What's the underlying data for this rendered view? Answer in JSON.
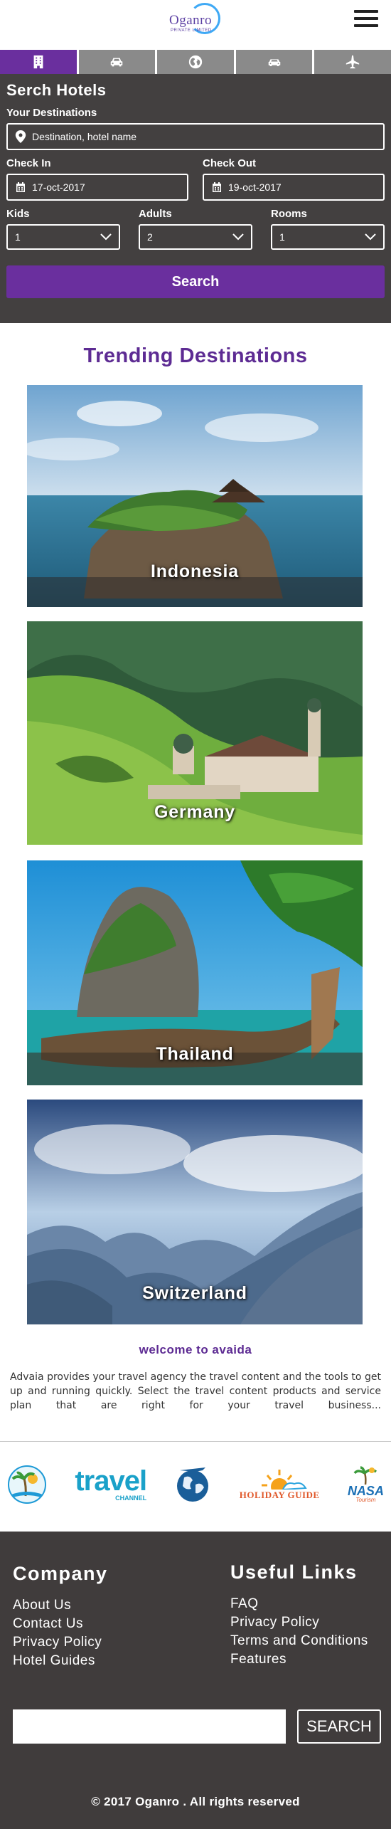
{
  "header": {
    "logo_text": "Oganro",
    "logo_sub": "PRIVATE LIMITED",
    "menu_icon": "hamburger-menu-icon"
  },
  "tabs": [
    {
      "icon": "hotel-building-icon",
      "active": true
    },
    {
      "icon": "car-icon",
      "active": false
    },
    {
      "icon": "globe-icon",
      "active": false
    },
    {
      "icon": "taxi-icon",
      "active": false
    },
    {
      "icon": "airplane-icon",
      "active": false
    }
  ],
  "search": {
    "title": "Serch Hotels",
    "destination_label": "Your Destinations",
    "destination_placeholder": "Destination, hotel name",
    "checkin_label": "Check In",
    "checkin_value": "17-oct-2017",
    "checkout_label": "Check Out",
    "checkout_value": "19-oct-2017",
    "kids_label": "Kids",
    "kids_value": "1",
    "adults_label": "Adults",
    "adults_value": "2",
    "rooms_label": "Rooms",
    "rooms_value": "1",
    "button_label": "Search"
  },
  "trending": {
    "title": "Trending Destinations",
    "destinations": [
      {
        "name": "Indonesia"
      },
      {
        "name": "Germany"
      },
      {
        "name": "Thailand"
      },
      {
        "name": "Switzerland"
      }
    ]
  },
  "welcome": {
    "title": "welcome to avaida",
    "text": "Advaia provides your travel agency the travel content and the tools to get up and running quickly. Select the travel content products and service plan that are right for your travel business..."
  },
  "partners": [
    {
      "name": "beach-resort-logo"
    },
    {
      "name": "Travel Channel",
      "text": "travel",
      "sub": "CHANNEL"
    },
    {
      "name": "globe-plane-logo"
    },
    {
      "name": "Holiday Guide",
      "text": "HOLIDAY GUIDE"
    },
    {
      "name": "NASA Tourism",
      "text": "NASA",
      "sub": "Tourism"
    }
  ],
  "footer": {
    "company_title": "Company",
    "company_links": [
      "About Us",
      "Contact Us",
      "Privacy Policy",
      "Hotel Guides"
    ],
    "useful_title": "Useful Links",
    "useful_links": [
      "FAQ",
      "Privacy Policy",
      "Terms and Conditions",
      "Features"
    ],
    "subscribe_button": "SEARCH",
    "copyright": "© 2017 Oganro . All rights reserved"
  },
  "colors": {
    "brand_purple": "#6a2f9e",
    "heading_purple": "#5d2b93",
    "panel_bg": "#434040",
    "footer_bg": "#403c3c",
    "tab_inactive": "#8a8a8a"
  }
}
